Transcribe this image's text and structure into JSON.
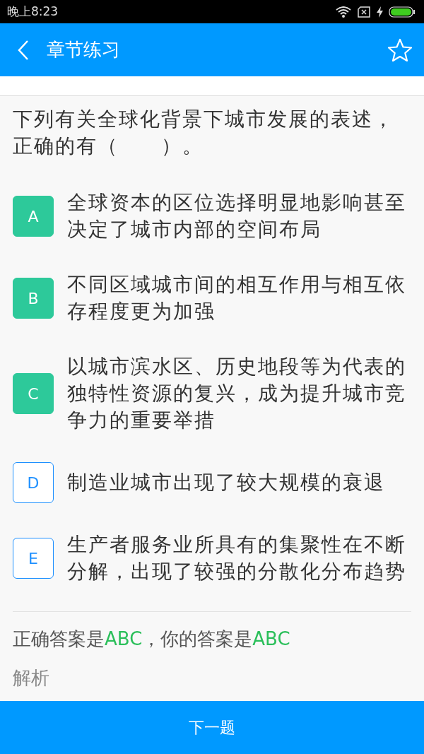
{
  "status_bar": {
    "time": "晚上8:23"
  },
  "header": {
    "title": "章节练习"
  },
  "question": "下列有关全球化背景下城市发展的表述，正确的有（　　）。",
  "options": [
    {
      "letter": "A",
      "text": "全球资本的区位选择明显地影响甚至决定了城市内部的空间布局",
      "selected": true
    },
    {
      "letter": "B",
      "text": "不同区域城市间的相互作用与相互依存程度更为加强",
      "selected": true
    },
    {
      "letter": "C",
      "text": "以城市滨水区、历史地段等为代表的独特性资源的复兴，成为提升城市竞争力的重要举措",
      "selected": true
    },
    {
      "letter": "D",
      "text": "制造业城市出现了较大规模的衰退",
      "selected": false
    },
    {
      "letter": "E",
      "text": "生产者服务业所具有的集聚性在不断分解，出现了较强的分散化分布趋势",
      "selected": false
    }
  ],
  "answer": {
    "correct_label": "正确答案是",
    "correct": "ABC",
    "yours_label": "，你的答案是",
    "yours": "ABC"
  },
  "analysis_label": "解析",
  "next_button": "下一题"
}
